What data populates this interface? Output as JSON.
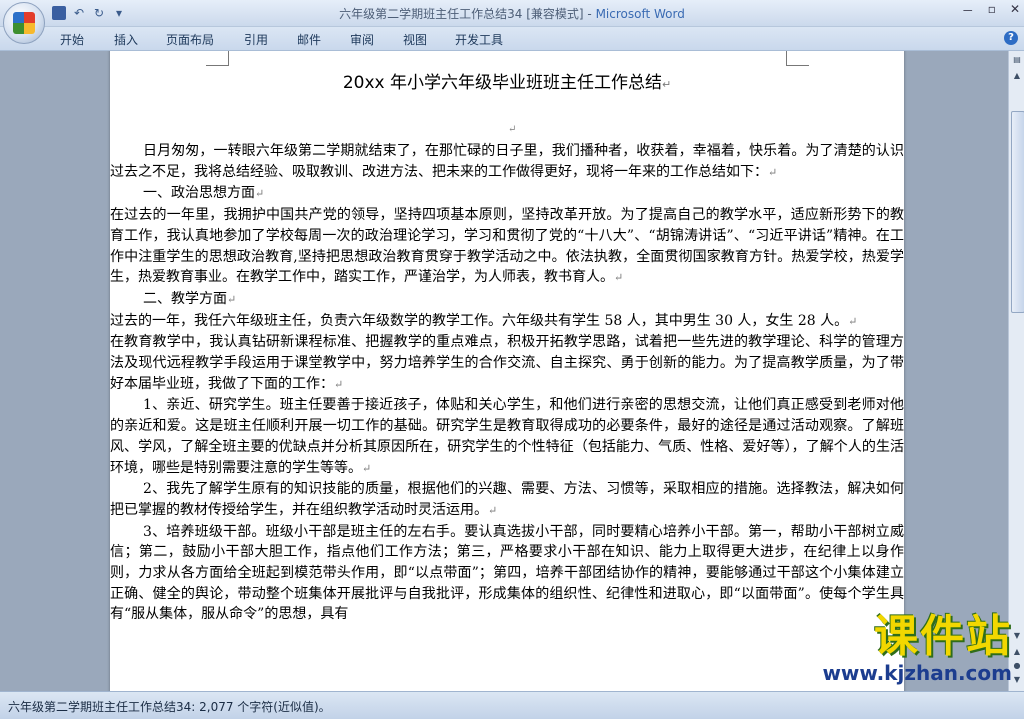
{
  "window": {
    "title_doc": "六年级第二学期班主任工作总结34 [兼容模式]",
    "title_sep": " - ",
    "title_app": "Microsoft Word"
  },
  "window_controls": {
    "minimize": "－",
    "maximize": "▫",
    "close": "✕"
  },
  "qat": {
    "undo": "↶",
    "redo": "↻",
    "customize": "▾"
  },
  "ribbon_tabs": [
    "开始",
    "插入",
    "页面布局",
    "引用",
    "邮件",
    "审阅",
    "视图",
    "开发工具"
  ],
  "help": "?",
  "document": {
    "title": "20xx 年小学六年级毕业班班主任工作总结",
    "paragraph_mark": "↵",
    "paragraphs": [
      {
        "indent": true,
        "text": "日月匆匆，一转眼六年级第二学期就结束了，在那忙碌的日子里，我们播种者，收获着，幸福着，快乐着。为了清楚的认识过去之不足，我将总结经验、吸取教训、改进方法、把未来的工作做得更好，现将一年来的工作总结如下："
      },
      {
        "indent": true,
        "text": "一、政治思想方面"
      },
      {
        "indent": false,
        "text": "在过去的一年里，我拥护中国共产党的领导，坚持四项基本原则，坚持改革开放。为了提高自己的教学水平，适应新形势下的教育工作，我认真地参加了学校每周一次的政治理论学习，学习和贯彻了党的“十八大”、“胡锦涛讲话”、“习近平讲话”精神。在工作中注重学生的思想政治教育,坚持把思想政治教育贯穿于教学活动之中。依法执教，全面贯彻国家教育方针。热爱学校，热爱学生，热爱教育事业。在教学工作中，踏实工作，严谨治学，为人师表，教书育人。"
      },
      {
        "indent": true,
        "text": "二、教学方面"
      },
      {
        "indent": false,
        "text": "过去的一年，我任六年级班主任，负责六年级数学的教学工作。六年级共有学生 58 人，其中男生 30 人，女生 28 人。"
      },
      {
        "indent": false,
        "text": "在教育教学中，我认真钻研新课程标准、把握教学的重点难点，积极开拓教学思路，试着把一些先进的教学理论、科学的管理方法及现代远程教学手段运用于课堂教学中，努力培养学生的合作交流、自主探究、勇于创新的能力。为了提高教学质量，为了带好本届毕业班，我做了下面的工作："
      },
      {
        "indent": true,
        "text": "1、亲近、研究学生。班主任要善于接近孩子，体贴和关心学生，和他们进行亲密的思想交流，让他们真正感受到老师对他的亲近和爱。这是班主任顺利开展一切工作的基础。研究学生是教育取得成功的必要条件，最好的途径是通过活动观察。了解班风、学风，了解全班主要的优缺点并分析其原因所在，研究学生的个性特征（包括能力、气质、性格、爱好等），了解个人的生活环境，哪些是特别需要注意的学生等等。"
      },
      {
        "indent": true,
        "text": "2、我先了解学生原有的知识技能的质量，根据他们的兴趣、需要、方法、习惯等，采取相应的措施。选择教法，解决如何把已掌握的教材传授给学生，并在组织教学活动时灵活运用。"
      },
      {
        "indent": true,
        "text": "3、培养班级干部。班级小干部是班主任的左右手。要认真选拔小干部，同时要精心培养小干部。第一，帮助小干部树立威信；第二，鼓励小干部大胆工作，指点他们工作方法；第三，严格要求小干部在知识、能力上取得更大进步，在纪律上以身作则，力求从各方面给全班起到模范带头作用，即“以点带面”；第四，培养干部团结协作的精神，要能够通过干部这个小集体建立正确、健全的舆论，带动整个班集体开展批评与自我批评，形成集体的组织性、纪律性和进取心，即“以面带面”。使每个学生具有“服从集体，服从命令”的思想，具有"
      }
    ]
  },
  "status_bar": {
    "text": "六年级第二学期班主任工作总结34: 2,077 个字符(近似值)。"
  },
  "watermark": {
    "main": "课件站",
    "url": "www.kjzhan.com"
  },
  "colors": {
    "ribbon_text": "#1e395b",
    "title_app": "#3a6bb3",
    "watermark_yellow": "#f2d700",
    "watermark_blue": "#1c3d8f"
  }
}
